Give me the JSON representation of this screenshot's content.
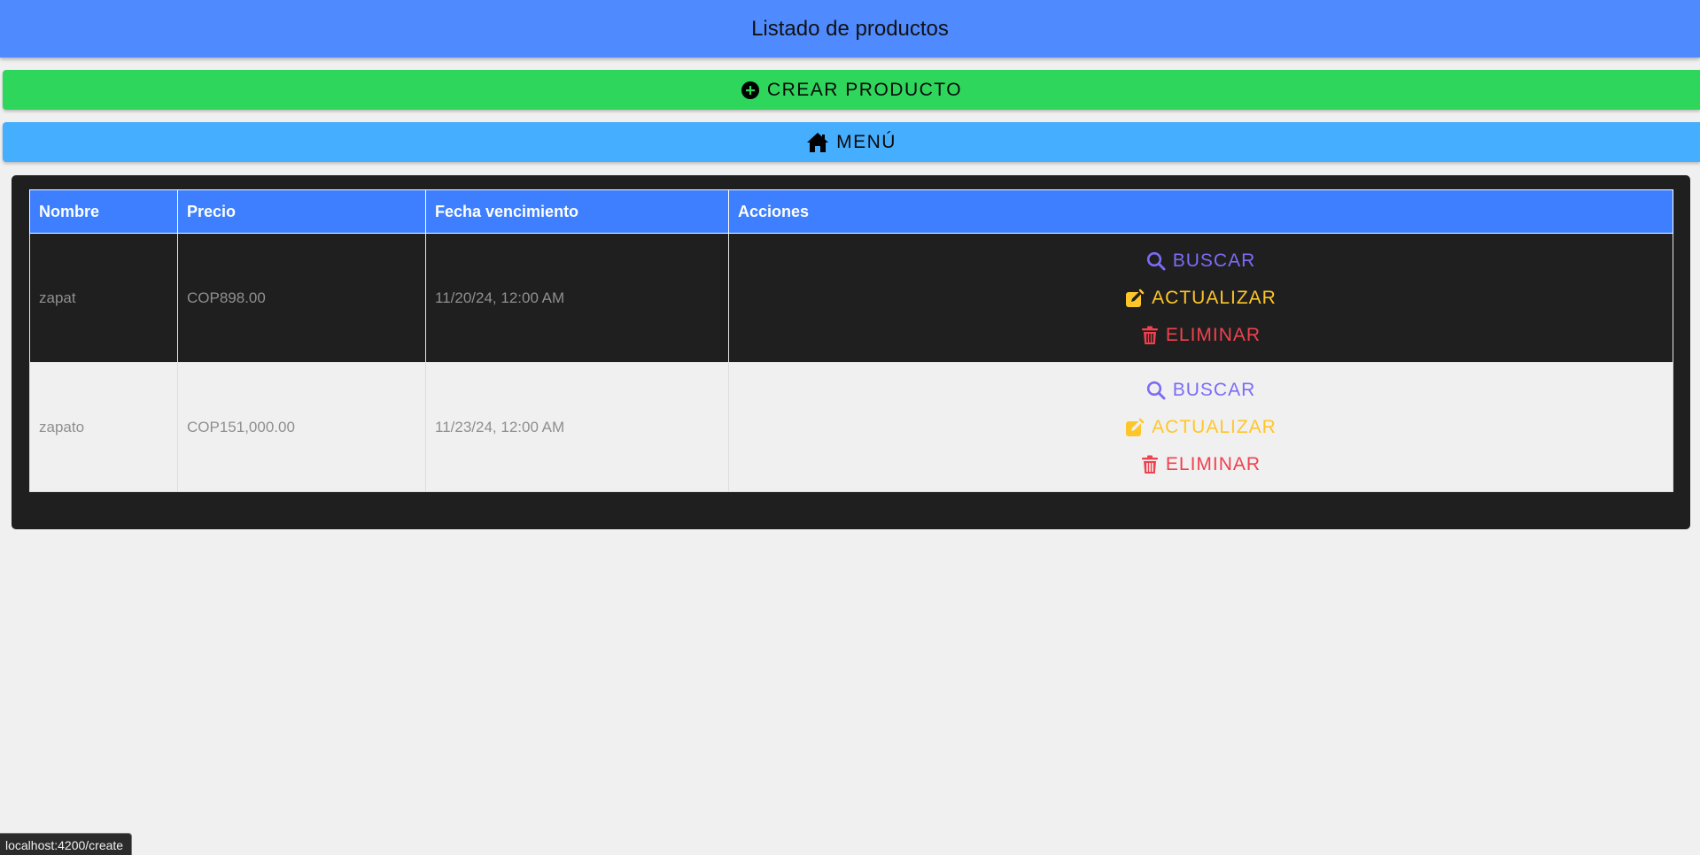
{
  "header": {
    "title": "Listado de productos"
  },
  "buttons": {
    "create_label": "CREAR PRODUCTO",
    "menu_label": "MENÚ"
  },
  "table": {
    "columns": [
      "Nombre",
      "Precio",
      "Fecha vencimiento",
      "Acciones"
    ],
    "rows": [
      {
        "nombre": "zapat",
        "precio": "COP898.00",
        "fecha": "11/20/24, 12:00 AM"
      },
      {
        "nombre": "zapato",
        "precio": "COP151,000.00",
        "fecha": "11/23/24, 12:00 AM"
      }
    ],
    "actions": {
      "search": "BUSCAR",
      "update": "ACTUALIZAR",
      "delete": "ELIMINAR"
    }
  },
  "status_bar": {
    "url": "localhost:4200/create"
  },
  "colors": {
    "header_bg": "#4f8bff",
    "create_bg": "#2fd65c",
    "menu_bg": "#46aeff",
    "table_header_bg": "#3d7fff",
    "search": "#7b6cf6",
    "update": "#ffc629",
    "delete": "#f0414f"
  }
}
